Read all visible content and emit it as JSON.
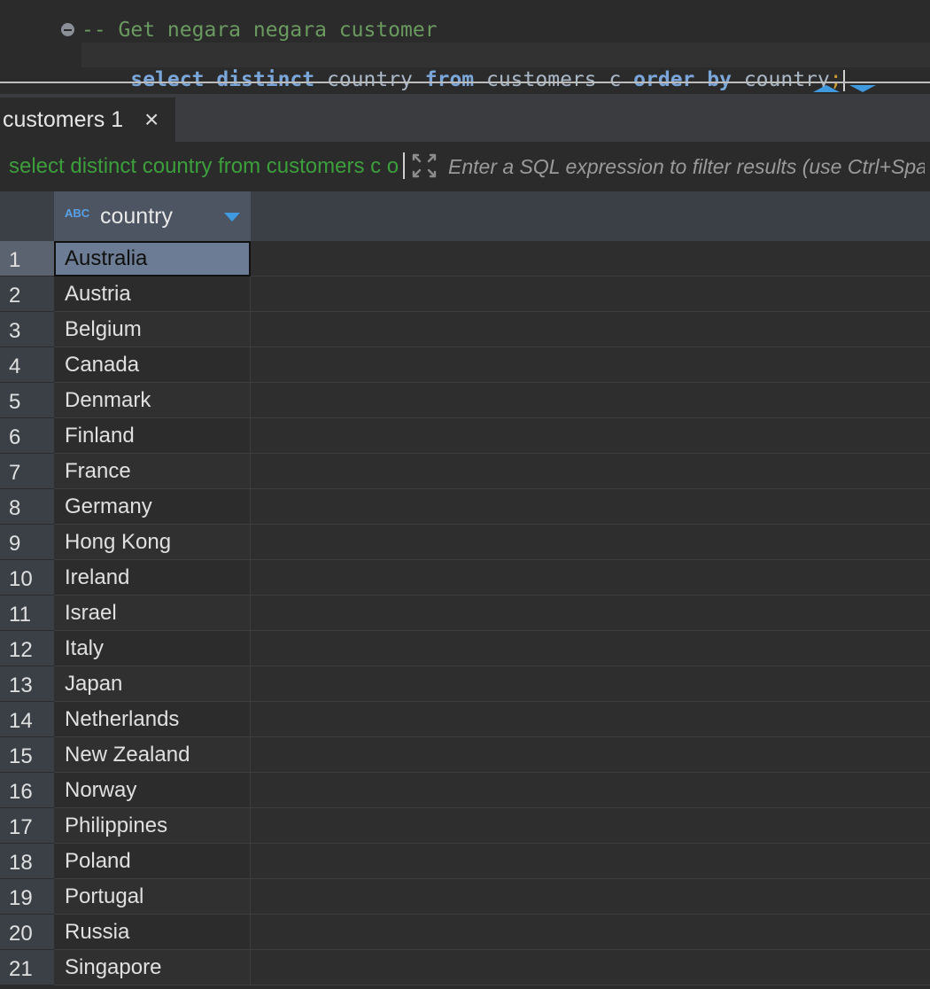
{
  "editor": {
    "comment": "-- Get negara negara customer",
    "query_tokens": [
      {
        "text": "select",
        "kw": true
      },
      {
        "text": " ",
        "kw": false
      },
      {
        "text": "distinct",
        "kw": true
      },
      {
        "text": " country ",
        "kw": false
      },
      {
        "text": "from",
        "kw": true
      },
      {
        "text": " customers c ",
        "kw": false
      },
      {
        "text": "order",
        "kw": true
      },
      {
        "text": " ",
        "kw": false
      },
      {
        "text": "by",
        "kw": true
      },
      {
        "text": " country",
        "kw": false
      }
    ],
    "terminator": ";",
    "fold_icon": "collapse-minus-icon"
  },
  "result_tabs": [
    {
      "label": "customers 1",
      "active": true,
      "close_icon": "×"
    }
  ],
  "filter_bar": {
    "query_label": "select distinct country from customers c order by country",
    "placeholder": "Enter a SQL expression to filter results (use Ctrl+Space)"
  },
  "grid": {
    "type_badge": "ABC",
    "column": "country",
    "selected_row": 1,
    "rows": [
      {
        "n": "1",
        "country": "Australia"
      },
      {
        "n": "2",
        "country": "Austria"
      },
      {
        "n": "3",
        "country": "Belgium"
      },
      {
        "n": "4",
        "country": "Canada"
      },
      {
        "n": "5",
        "country": "Denmark"
      },
      {
        "n": "6",
        "country": "Finland"
      },
      {
        "n": "7",
        "country": "France"
      },
      {
        "n": "8",
        "country": "Germany"
      },
      {
        "n": "9",
        "country": "Hong Kong"
      },
      {
        "n": "10",
        "country": "Ireland"
      },
      {
        "n": "11",
        "country": "Israel"
      },
      {
        "n": "12",
        "country": "Italy"
      },
      {
        "n": "13",
        "country": "Japan"
      },
      {
        "n": "14",
        "country": "Netherlands"
      },
      {
        "n": "15",
        "country": "New Zealand"
      },
      {
        "n": "16",
        "country": "Norway"
      },
      {
        "n": "17",
        "country": "Philippines"
      },
      {
        "n": "18",
        "country": "Poland"
      },
      {
        "n": "19",
        "country": "Portugal"
      },
      {
        "n": "20",
        "country": "Russia"
      },
      {
        "n": "21",
        "country": "Singapore"
      }
    ]
  },
  "colors": {
    "background": "#2b2b2b",
    "keyword": "#7aa6da",
    "comment": "#6a9a5f",
    "query_label": "#3c9f3c",
    "accent": "#3f9ae0",
    "selected_cell": "#6c7c94"
  }
}
